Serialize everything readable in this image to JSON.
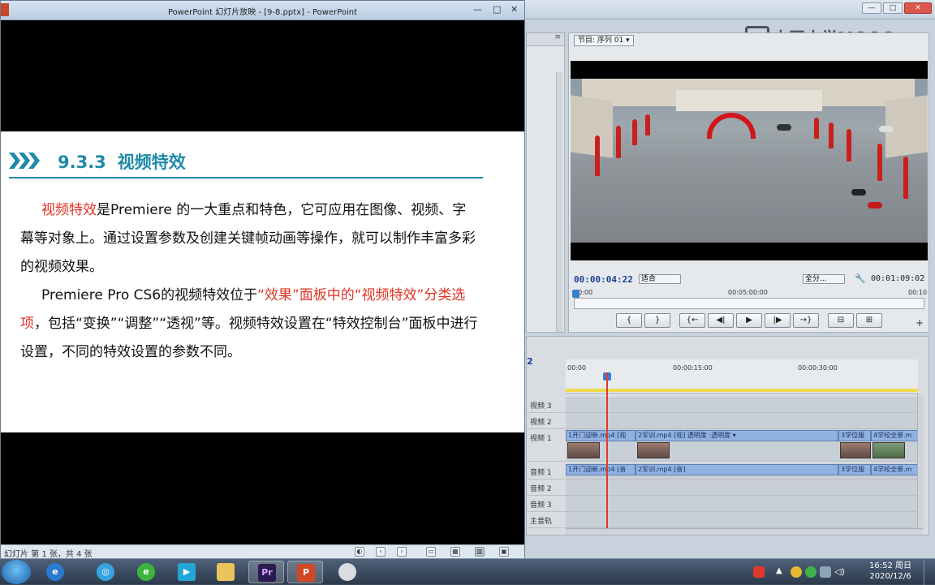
{
  "premiere": {
    "monitor_tab": "节目: 序列 01 ▾",
    "timecode_current": "00:00:04:22",
    "fit": "适合",
    "resolution": "全分...",
    "timecode_duration": "00:01:09:02",
    "ruler": [
      "00:00",
      "00:05:00:00",
      "00:10"
    ],
    "transport": [
      "{",
      "}",
      "{←",
      "◀|",
      "▶",
      "|▶",
      "→}",
      "⊟",
      "⊞"
    ],
    "timeline": {
      "seq_num": "2",
      "ruler": [
        "00:00",
        "00:00:15:00",
        "00:00:30:00"
      ],
      "tracks": {
        "v3": "视频 3",
        "v2": "视频 2",
        "v1": "视频 1",
        "a1": "音频 1",
        "a2": "音频 2",
        "a3": "音频 3",
        "master": "主音轨"
      },
      "clips": {
        "v1_a": "1开门迎新.mp4 [视",
        "v1_b": "2军训.mp4 [视] 透明度 :透明度 ▾",
        "v1_c": "3学位服",
        "v1_d": "4学校全景.m",
        "a1_a": "1开门迎新.mp4 [音",
        "a1_b": "2军训.mp4 [音]",
        "a1_c": "3学位服",
        "a1_d": "4学校全景.m"
      }
    },
    "logo": "中国大学MOOC"
  },
  "ppt": {
    "title": "PowerPoint 幻灯片放映 - [9-8.pptx] - PowerPoint",
    "heading_num": "9.3.3",
    "heading_text": "视频特效",
    "p1_red": "视频特效",
    "p1_rest": "是Premiere 的一大重点和特色，它可应用在图像、视频、字幕等对象上。通过设置参数及创建关键帧动画等操作，就可以制作丰富多彩的视频效果。",
    "p2_a": "Premiere Pro CS6的视频特效位于",
    "p2_red": "“效果”面板中的“视频特效”分类选项",
    "p2_b": "，包括“变换”“调整”“透视”等。视频特效设置在“特效控制台”面板中进行设置，不同的特效设置的参数不同。",
    "status": "幻灯片 第 1 张，共 4 张"
  },
  "taskbar": {
    "premiere_label": "Pr",
    "ppt_label": "P",
    "clock_time": "16:52 周日",
    "clock_date": "2020/12/6"
  },
  "colors": {
    "accent_teal": "#1f8aa8",
    "accent_red": "#e03224",
    "timecode_blue": "#1c3f9c"
  }
}
